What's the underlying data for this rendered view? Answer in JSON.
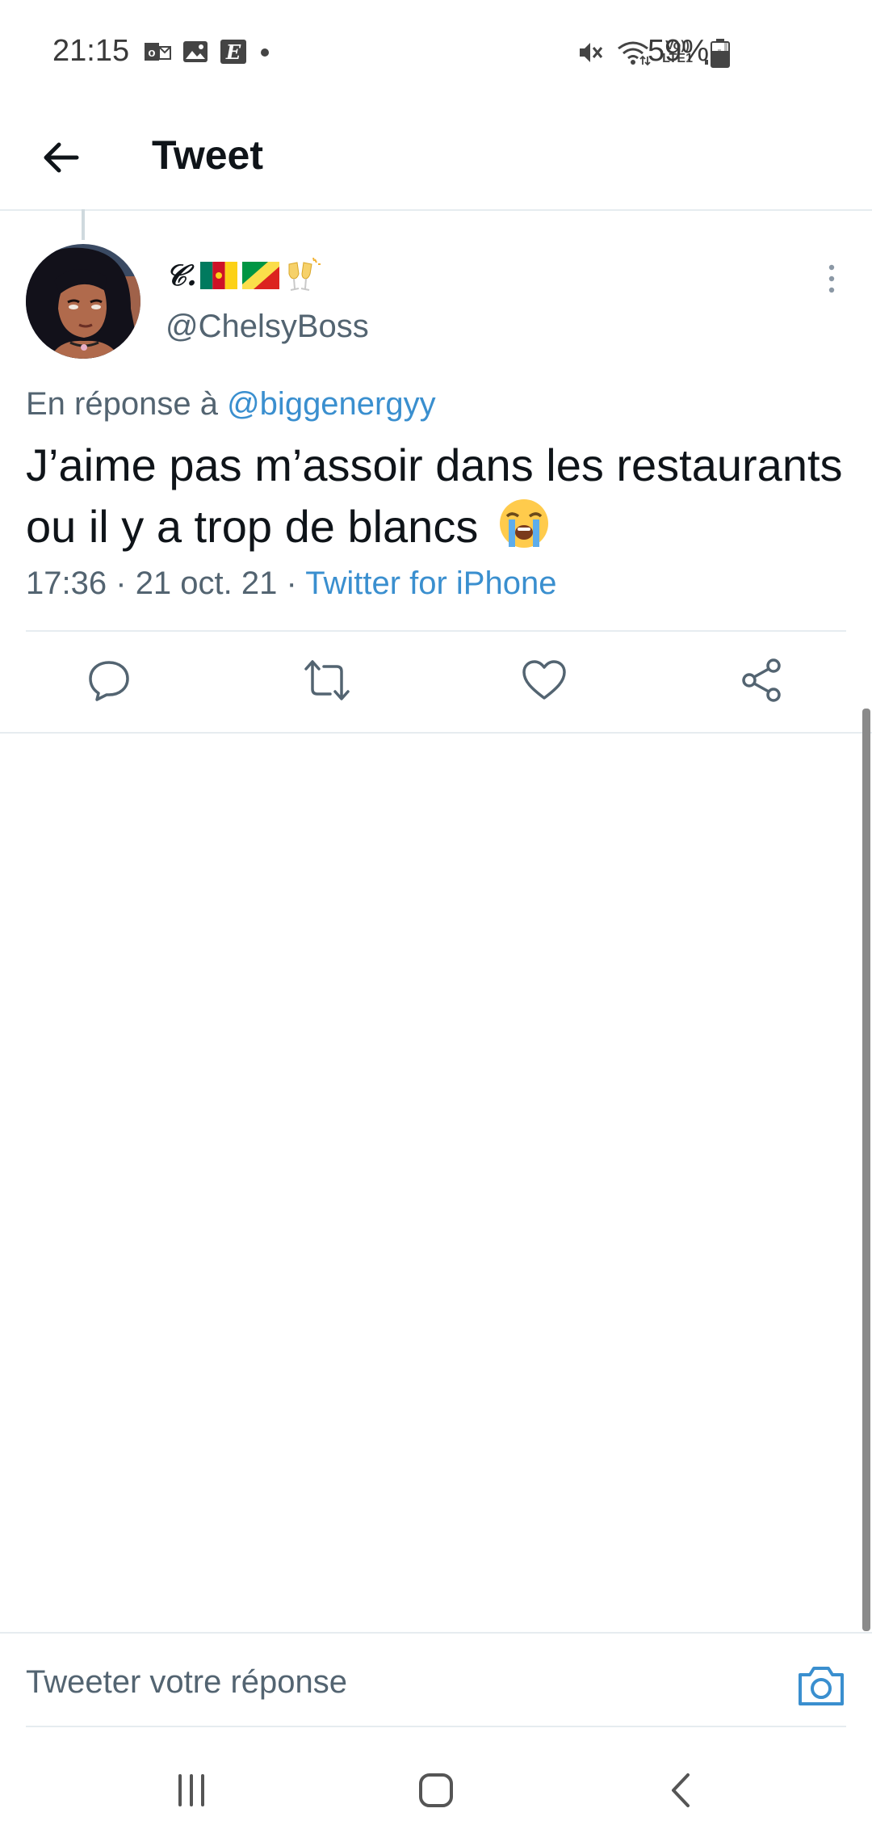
{
  "status_bar": {
    "time": "21:15",
    "left_icons": [
      "outlook-icon",
      "gallery-icon",
      "e-app-icon",
      "dot-icon"
    ],
    "right_icons": [
      "mute-vibrate-icon",
      "wifi-icon",
      "volte-icon",
      "signal-icon"
    ],
    "volte_top": "Vo))",
    "volte_bottom": "LTE1",
    "battery_text": "59%",
    "battery_level": 0.59
  },
  "header": {
    "title": "Tweet"
  },
  "tweet": {
    "display_name": "𝒞.",
    "name_emojis": [
      "flag-cameroon-icon",
      "flag-congo-icon",
      "clinking-glasses-icon"
    ],
    "handle": "@ChelsyBoss",
    "reply_prefix": "En réponse à",
    "reply_mention": "@biggenergyy",
    "text": "J’aime pas m’assoir dans les restaurants ou il y a trop de blancs",
    "text_emoji": "😭",
    "time": "17:36",
    "date": "21 oct. 21",
    "separator": "·",
    "source": "Twitter for iPhone"
  },
  "actions": [
    "reply-icon",
    "retweet-icon",
    "like-icon",
    "share-icon"
  ],
  "compose": {
    "placeholder": "Tweeter votre réponse"
  },
  "colors": {
    "accent": "#3a8fcf",
    "secondary_text": "#536471",
    "divider": "#e6ecf0"
  }
}
